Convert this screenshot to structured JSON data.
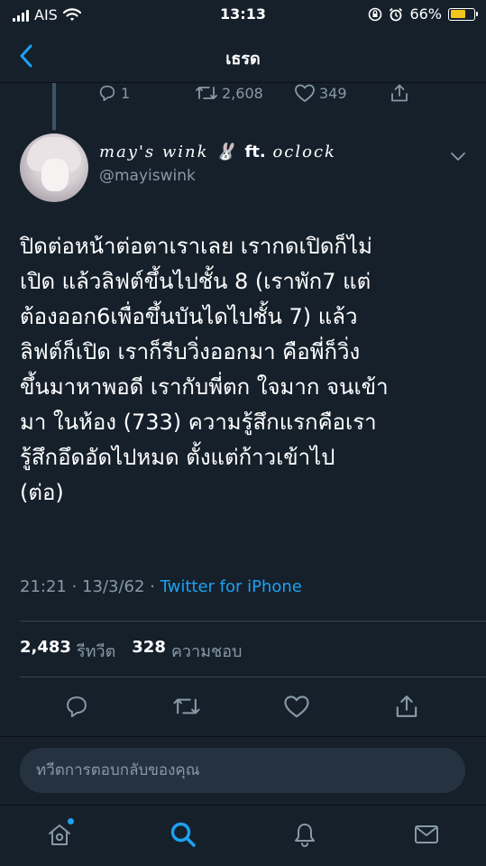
{
  "status_bar": {
    "carrier": "AIS",
    "time": "13:13",
    "battery": "66%",
    "battery_level": 0.66
  },
  "header": {
    "title": "เธรด"
  },
  "previous_tweet": {
    "replies": "1",
    "retweets": "2,608",
    "likes": "349"
  },
  "tweet": {
    "display_name": "may's wink",
    "name_emoji": "🐰",
    "name_suffix": "ft.",
    "name_suffix_2": "oclock",
    "username": "@mayiswink",
    "text": "ปิดต่อหน้าต่อตาเราเลย เรากดเปิดก็ไม่\nเปิด แล้วลิฟต์ขึ้นไปชั้น 8 (เราพัก7 แต่\nต้องออก6เพื่อขึ้นบันไดไปชั้น 7) แล้ว\nลิฟต์ก็เปิด เราก็รีบวิ่งออกมา คือพี่ก็วิ่ง\nขึ้นมาหาพอดี เรากับพี่ตก ใจมาก จนเข้า\nมา ในห้อง (733) ความรู้สึกแรกคือเรา\nรู้สึกอึดอัดไปหมด ตั้งแต่ก้าวเข้าไป\n(ต่อ)",
    "time": "21:21 · 13/3/62 · ",
    "source": "Twitter for iPhone",
    "retweet_count": "2,483",
    "retweet_label": "รีทวีต",
    "like_count": "328",
    "like_label": "ความชอบ"
  },
  "reply": {
    "placeholder": "ทวีตการตอบกลับของคุณ"
  },
  "colors": {
    "background": "#15202b",
    "accent": "#1da1f2",
    "muted": "#8899a6",
    "battery": "#f3c51a"
  },
  "icons": {
    "actions": [
      "reply-icon",
      "retweet-icon",
      "like-icon",
      "share-icon"
    ],
    "tabs": [
      "home-icon",
      "search-icon",
      "notifications-icon",
      "messages-icon"
    ]
  }
}
